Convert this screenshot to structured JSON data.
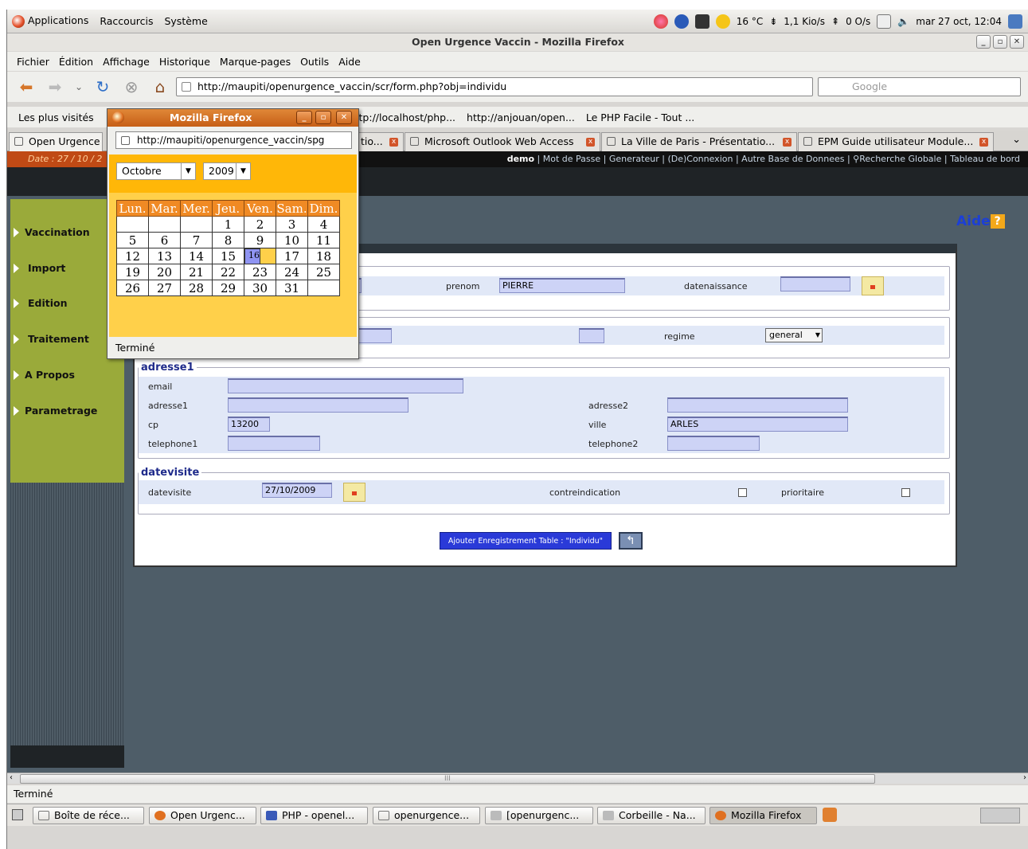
{
  "panel": {
    "menus": [
      "Applications",
      "Raccourcis",
      "Système"
    ],
    "weather": "16 °C",
    "net_down": "1,1 Kio/s",
    "net_up": "0 O/s",
    "clock": "mar 27 oct, 12:04"
  },
  "window": {
    "title": "Open Urgence Vaccin - Mozilla Firefox"
  },
  "menubar": [
    "Fichier",
    "Édition",
    "Affichage",
    "Historique",
    "Marque-pages",
    "Outils",
    "Aide"
  ],
  "navbar": {
    "url": "http://maupiti/openurgence_vaccin/scr/form.php?obj=individu",
    "search_placeholder": "Google"
  },
  "bookmarks": [
    "Les plus visités",
    "http://localhost/php...",
    "http://anjouan/open...",
    "Le PHP Facile - Tout ..."
  ],
  "tabs": [
    "Open Urgence",
    "tio...",
    "Microsoft Outlook Web Access",
    "La Ville de Paris - Présentatio...",
    "EPM Guide utilisateur Module..."
  ],
  "page": {
    "date_label": "Date : 27 / 10 / 2",
    "user": "demo",
    "links": [
      "Mot de Passe",
      "Generateur",
      "(De)Connexion",
      "Autre Base de Donnees",
      "Recherche Globale",
      "Tableau de bord"
    ],
    "aide": "Aide",
    "aide_q": "?",
    "sidebar": [
      "Vaccination",
      "Import",
      "Edition",
      "Traitement",
      "A Propos",
      "Parametrage"
    ],
    "form": {
      "prenom_label": "prenom",
      "prenom_value": "PIERRE",
      "datenaissance_label": "datenaissance",
      "datenaissance_value": "",
      "regime_label": "regime",
      "regime_value": "general",
      "adresse1_legend": "adresse1",
      "email_label": "email",
      "email_value": "",
      "adresse1_label": "adresse1",
      "adresse1_value": "",
      "adresse2_label": "adresse2",
      "adresse2_value": "",
      "cp_label": "cp",
      "cp_value": "13200",
      "ville_label": "ville",
      "ville_value": "ARLES",
      "telephone1_label": "telephone1",
      "telephone1_value": "",
      "telephone2_label": "telephone2",
      "telephone2_value": "",
      "datevisite_legend": "datevisite",
      "datevisite_label": "datevisite",
      "datevisite_value": "27/10/2009",
      "contreindication_label": "contreindication",
      "prioritaire_label": "prioritaire",
      "add_button": "Ajouter Enregistrement Table : \"Individu\""
    }
  },
  "popup": {
    "title": "Mozilla Firefox",
    "url": "http://maupiti/openurgence_vaccin/spg",
    "month": "Octobre",
    "year": "2009",
    "weekdays": [
      "Lun.",
      "Mar.",
      "Mer.",
      "Jeu.",
      "Ven.",
      "Sam.",
      "Dim."
    ],
    "weeks": [
      [
        "",
        "",
        "",
        "1",
        "2",
        "3",
        "4"
      ],
      [
        "5",
        "6",
        "7",
        "8",
        "9",
        "10",
        "11"
      ],
      [
        "12",
        "13",
        "14",
        "15",
        "16",
        "17",
        "18"
      ],
      [
        "19",
        "20",
        "21",
        "22",
        "23",
        "24",
        "25"
      ],
      [
        "26",
        "27",
        "28",
        "29",
        "30",
        "31",
        ""
      ]
    ],
    "selected": "16",
    "status": "Terminé"
  },
  "scroll_mark": "III",
  "status": "Terminé",
  "taskbar": [
    "Boîte de réce...",
    "Open Urgenc...",
    "PHP - openel...",
    "openurgence...",
    "[openurgenc...",
    "Corbeille - Na...",
    "Mozilla Firefox"
  ]
}
